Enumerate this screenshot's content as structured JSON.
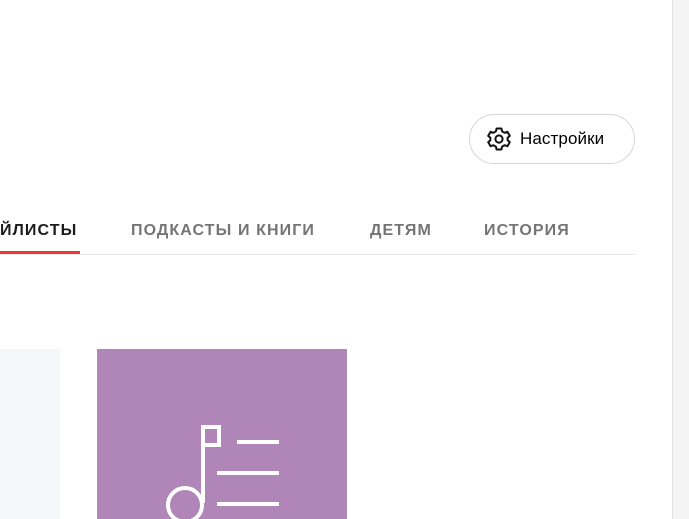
{
  "header": {
    "settings_label": "Настройки",
    "settings_icon": "gear-icon"
  },
  "tabs": [
    {
      "label": "ЙЛИСТЫ",
      "active": true
    },
    {
      "label": "ПОДКАСТЫ И КНИГИ",
      "active": false
    },
    {
      "label": "ДЕТЯМ",
      "active": false
    },
    {
      "label": "ИСТОРИЯ",
      "active": false
    }
  ],
  "cards": [
    {
      "kind": "placeholder",
      "color": "#f5f6f8"
    },
    {
      "kind": "playlist-cover",
      "icon": "playlist-music-icon",
      "color": "#b085b8"
    }
  ],
  "colors": {
    "accent": "#e63a34",
    "tab_inactive": "#757575",
    "tab_active": "#1b1b1b"
  }
}
